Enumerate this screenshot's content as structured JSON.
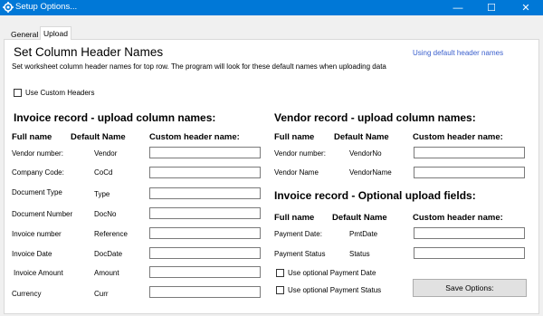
{
  "window": {
    "title": "Setup Options...",
    "controls": {
      "minimize": "—",
      "maximize": "☐",
      "close": "✕"
    }
  },
  "tabs": [
    {
      "label": "General",
      "selected": false
    },
    {
      "label": "Upload",
      "selected": true
    }
  ],
  "header": {
    "title": "Set Column Header Names",
    "status_link": "Using default header names",
    "description": "Set worksheet column header names for top row. The program will look for these default names when uploading data"
  },
  "custom_headers_checkbox": {
    "label": "Use Custom Headers",
    "checked": false
  },
  "columns": {
    "full_name": "Full name",
    "default_name": "Default Name",
    "custom_name": "Custom header name:"
  },
  "invoice_section": {
    "title": "Invoice record - upload column names:",
    "rows": [
      {
        "full": "Vendor number:",
        "default": "Vendor",
        "value": ""
      },
      {
        "full": "Company Code:",
        "default": "CoCd",
        "value": ""
      },
      {
        "full": "Document Type",
        "default": "Type",
        "value": ""
      },
      {
        "full": "Document Number",
        "default": "DocNo",
        "value": ""
      },
      {
        "full": "Invoice number",
        "default": "Reference",
        "value": ""
      },
      {
        "full": "Invoice  Date",
        "default": "DocDate",
        "value": ""
      },
      {
        "full": "Invoice Amount",
        "default": "Amount",
        "value": ""
      },
      {
        "full": "Currency",
        "default": "Curr",
        "value": ""
      }
    ]
  },
  "vendor_section": {
    "title": "Vendor record - upload column names:",
    "rows": [
      {
        "full": "Vendor number:",
        "default": "VendorNo",
        "value": ""
      },
      {
        "full": "Vendor Name",
        "default": "VendorName",
        "value": ""
      }
    ]
  },
  "optional_section": {
    "title": "Invoice record - Optional upload fields:",
    "rows": [
      {
        "full": "Payment Date:",
        "default": "PmtDate",
        "value": ""
      },
      {
        "full": "Payment Status",
        "default": "Status",
        "value": ""
      }
    ],
    "checkboxes": [
      {
        "label": "Use optional Payment Date",
        "checked": false
      },
      {
        "label": "Use optional Payment Status",
        "checked": false
      }
    ]
  },
  "save_button": "Save Options:",
  "colors": {
    "titlebar": "#0078d7",
    "link": "#3a5fcd"
  }
}
